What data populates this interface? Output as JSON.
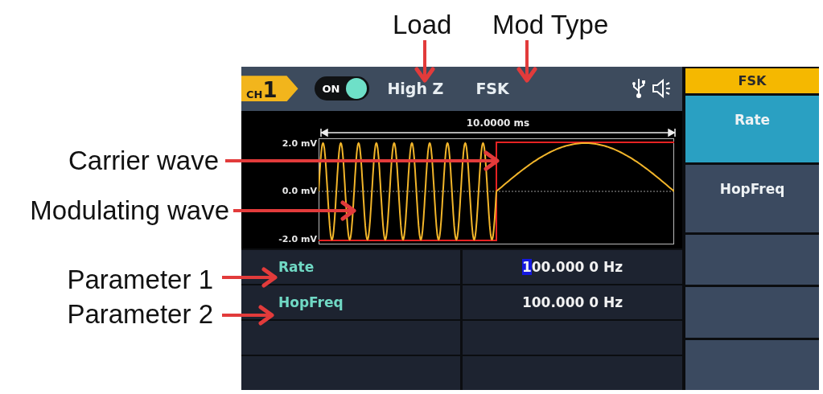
{
  "callouts": {
    "top": [
      "Load",
      "Mod Type"
    ],
    "left": [
      "Carrier wave",
      "Modulating wave",
      "Parameter 1",
      "Parameter 2"
    ]
  },
  "status_bar": {
    "channel": {
      "prefix": "CH",
      "number": "1"
    },
    "output": {
      "label": "ON",
      "on": true
    },
    "load": "High Z",
    "mod_type": "FSK"
  },
  "waveform": {
    "span": "10.0000 ms",
    "y_labels": [
      "2.0 mV",
      "0.0 mV",
      "-2.0 mV"
    ]
  },
  "params": [
    {
      "name": "Rate",
      "value": "100.000 0 Hz",
      "selected": true
    },
    {
      "name": "HopFreq",
      "value": "100.000 0 Hz",
      "selected": false
    }
  ],
  "menu": {
    "title": "FSK",
    "items": [
      {
        "label": "Rate",
        "selected": true
      },
      {
        "label": "HopFreq",
        "selected": false
      }
    ]
  }
}
